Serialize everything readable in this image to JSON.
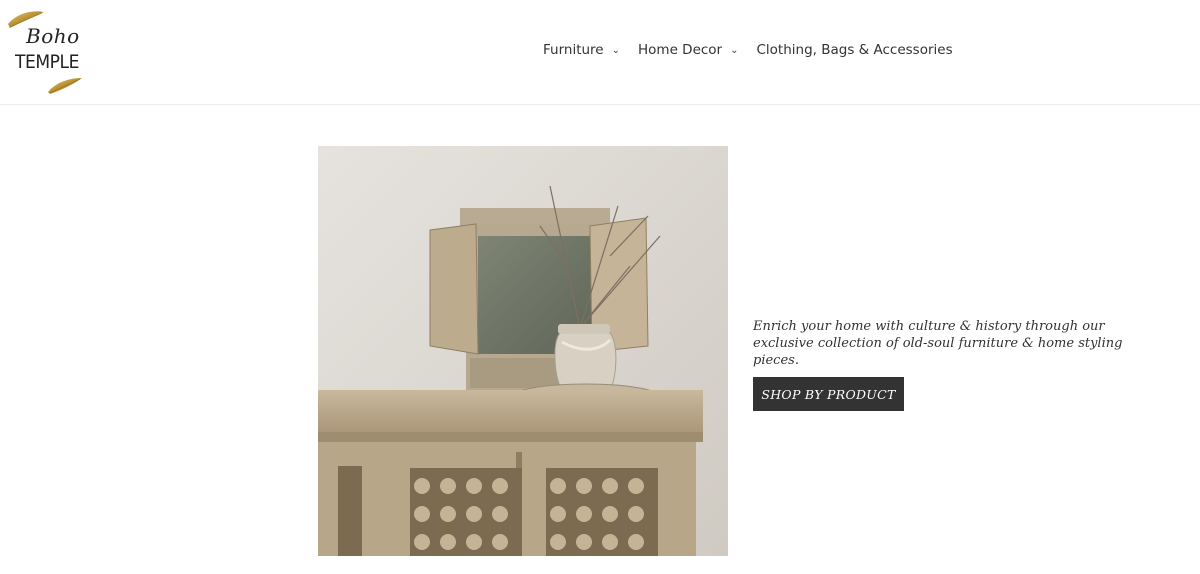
{
  "brand": {
    "logo_script": "Boho",
    "logo_word": "TEMPLE",
    "accent": "#c9a24a"
  },
  "nav": {
    "items": [
      {
        "label": "Furniture",
        "has_dropdown": true
      },
      {
        "label": "Home Decor",
        "has_dropdown": true
      },
      {
        "label": "Clothing, Bags & Accessories",
        "has_dropdown": false
      }
    ],
    "chevron": "chevron-down-icon"
  },
  "hero": {
    "image": "hero-cabinet-mirror-photo",
    "text": "Enrich your home with culture & history through our exclusive collection of old-soul furniture & home styling pieces.",
    "cta_label": "SHOP BY PRODUCT",
    "cta_bg": "#333333",
    "cta_fg": "#ffffff"
  }
}
